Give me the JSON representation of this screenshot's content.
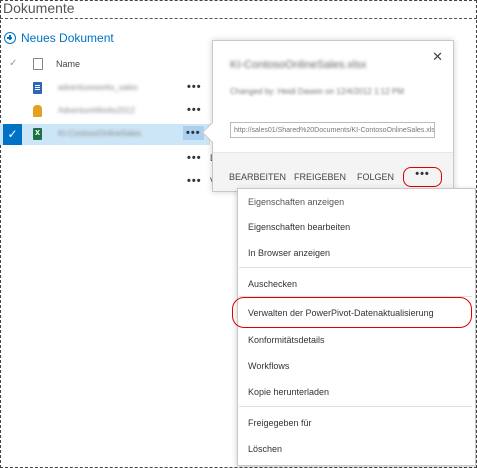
{
  "page": {
    "title": "Dokumente"
  },
  "toolbar": {
    "new_document_label": "Neues Dokument"
  },
  "list": {
    "column_name": "Name",
    "rows": [
      {
        "name": "adventureworks_sales",
        "trail": ""
      },
      {
        "name": "AdventureWorks2012",
        "trail": ""
      },
      {
        "name": "KI-ContosoOnlineSales",
        "trail": ""
      },
      {
        "name": "",
        "trail": "D"
      },
      {
        "name": "",
        "trail": "V"
      }
    ]
  },
  "callout": {
    "file_name": "KI-ContosoOnlineSales.xlsx",
    "changed_text": "Changed by: Heidi Dasein on 12/4/2012 1:12 PM",
    "url": "http://sales01/Shared%20Documents/KI-ContosoOnlineSales.xlsx",
    "actions": {
      "edit": "BEARBEITEN",
      "share": "FREIGEBEN",
      "follow": "FOLGEN",
      "more": "•••"
    }
  },
  "menu": {
    "items": [
      "Eigenschaften anzeigen",
      "Eigenschaften bearbeiten",
      "In Browser anzeigen",
      "Auschecken",
      "Verwalten der PowerPivot-Datenaktualisierung",
      "Konformitätsdetails",
      "Workflows",
      "Kopie herunterladen",
      "Freigegeben für",
      "Löschen"
    ]
  },
  "colors": {
    "accent": "#0072c6",
    "highlight": "#dd0000",
    "selected_row": "#cde6f7"
  }
}
